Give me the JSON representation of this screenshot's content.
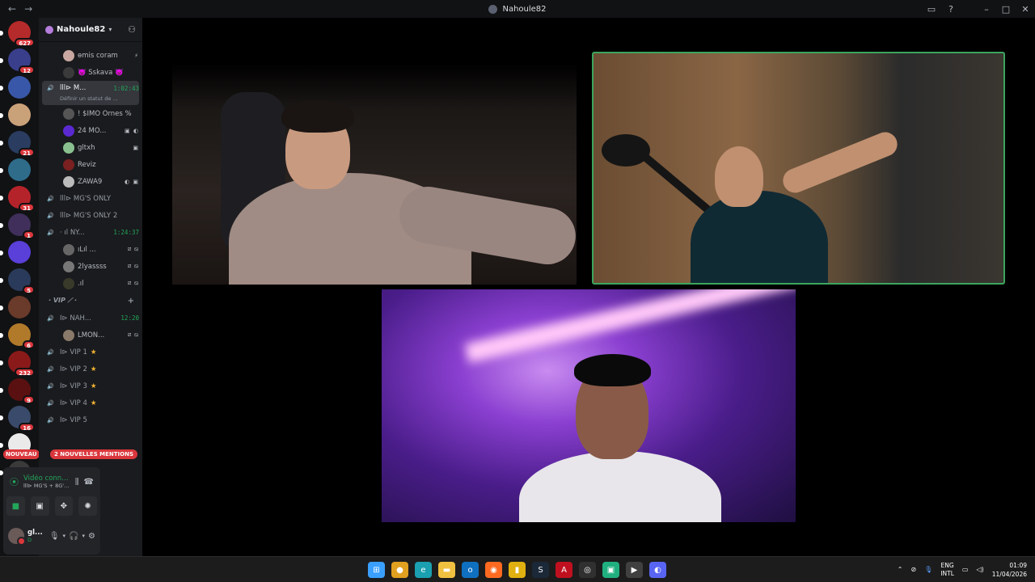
{
  "window": {
    "title": "Nahoule82"
  },
  "guilds": [
    {
      "name": "guild-home",
      "badge": "627",
      "color": "#b52a2a"
    },
    {
      "name": "guild-2",
      "badge": "12",
      "color": "#3a3f8c"
    },
    {
      "name": "guild-3",
      "badge": "",
      "color": "#3957a8"
    },
    {
      "name": "guild-4",
      "badge": "",
      "color": "#caa27a"
    },
    {
      "name": "guild-5",
      "badge": "21",
      "color": "#2a3d60"
    },
    {
      "name": "guild-6",
      "badge": "",
      "color": "#2e6c8a"
    },
    {
      "name": "guild-7",
      "badge": "31",
      "color": "#b5232a"
    },
    {
      "name": "guild-8",
      "badge": "1",
      "color": "#3f2f5a"
    },
    {
      "name": "guild-9",
      "badge": "",
      "color": "#5a3fd8"
    },
    {
      "name": "guild-10",
      "badge": "5",
      "color": "#2a3a5a"
    },
    {
      "name": "guild-11",
      "badge": "",
      "color": "#6a3a2a"
    },
    {
      "name": "guild-12",
      "badge": "6",
      "color": "#b07a2a"
    },
    {
      "name": "guild-13",
      "badge": "232",
      "color": "#8a1a1a"
    },
    {
      "name": "guild-14",
      "badge": "9",
      "color": "#5a1010"
    },
    {
      "name": "guild-15",
      "badge": "16",
      "color": "#3a4a6a"
    },
    {
      "name": "guild-16",
      "badge": "356",
      "color": "#eaeaea"
    },
    {
      "name": "guild-17",
      "badge": "",
      "color": "#3a3a3a"
    }
  ],
  "nouveau_label": "NOUVEAU",
  "server": {
    "name": "Nahoule82"
  },
  "channels": {
    "top_users": [
      {
        "name": "ɵmis coram",
        "icons": "⚡"
      },
      {
        "name": "👿 Sskava 👿",
        "icons": ""
      }
    ],
    "selected": {
      "name": "lll⊳ M...",
      "time": "1:02:43",
      "status": "Définir un statut de ..."
    },
    "selected_users": [
      {
        "name": "! $IMO Ornes %",
        "icons": ""
      },
      {
        "name": "24 MO...",
        "icons": "▣ ◐"
      },
      {
        "name": "gltxh",
        "icons": "▣"
      },
      {
        "name": "Reviz",
        "icons": ""
      },
      {
        "name": "ZAWA9",
        "icons": "◐ ▣"
      }
    ],
    "voice": [
      {
        "name": "lll⊳ MG'S ONLY",
        "time": ""
      },
      {
        "name": "lll⊳ MG'S ONLY 2",
        "time": ""
      }
    ],
    "ny": {
      "name": "· ıl NY...",
      "time": "1:24:37"
    },
    "ny_users": [
      {
        "name": "ıLıl ...",
        "icons": "⧄ ⧅"
      },
      {
        "name": "2lyassss",
        "icons": "⧄ ⧅"
      },
      {
        "name": ".ıl",
        "icons": "⧄ ⧅"
      }
    ],
    "category": "· VIP ⟋ ·",
    "nah": {
      "name": "I⊳ NAH...",
      "time": "12:20"
    },
    "nah_users": [
      {
        "name": "LMON...",
        "icons": "⧄ ⧅"
      }
    ],
    "vip": [
      {
        "name": "I⊳ VIP 1",
        "star": "★"
      },
      {
        "name": "I⊳ VIP 2",
        "star": "★"
      },
      {
        "name": "I⊳ VIP 3",
        "star": "★"
      },
      {
        "name": "I⊳ VIP 4",
        "star": "★"
      },
      {
        "name": "I⊳ VIP 5",
        "star": ""
      }
    ]
  },
  "mentions_label": "2 NOUVELLES MENTIONS",
  "voice_panel": {
    "status": "Vidéo connecté",
    "channel": "lll⊳ MG'S + 8G'S 1..."
  },
  "user_panel": {
    "name": "gl...",
    "status": "D"
  },
  "taskbar": {
    "apps": [
      {
        "name": "windows-start",
        "color": "#3aa0ff",
        "glyph": "⊞"
      },
      {
        "name": "chrome",
        "color": "#e0a020",
        "glyph": "●"
      },
      {
        "name": "edge",
        "color": "#1aa0b0",
        "glyph": "e"
      },
      {
        "name": "file-explorer",
        "color": "#f0c040",
        "glyph": "▬"
      },
      {
        "name": "outlook",
        "color": "#1070c0",
        "glyph": "o"
      },
      {
        "name": "firefox",
        "color": "#ff6a20",
        "glyph": "◉"
      },
      {
        "name": "app-yellow",
        "color": "#e0b010",
        "glyph": "▮"
      },
      {
        "name": "steam",
        "color": "#1b2838",
        "glyph": "S"
      },
      {
        "name": "app-red",
        "color": "#c01020",
        "glyph": "A"
      },
      {
        "name": "app-spotify",
        "color": "#303030",
        "glyph": "◎"
      },
      {
        "name": "app-green",
        "color": "#20b080",
        "glyph": "▣"
      },
      {
        "name": "app-player",
        "color": "#404040",
        "glyph": "▶"
      },
      {
        "name": "discord",
        "color": "#5865f2",
        "glyph": "◐"
      }
    ],
    "lang": "ENG",
    "layout": "INTL",
    "time": "01:09",
    "date": "11/04/2026"
  }
}
